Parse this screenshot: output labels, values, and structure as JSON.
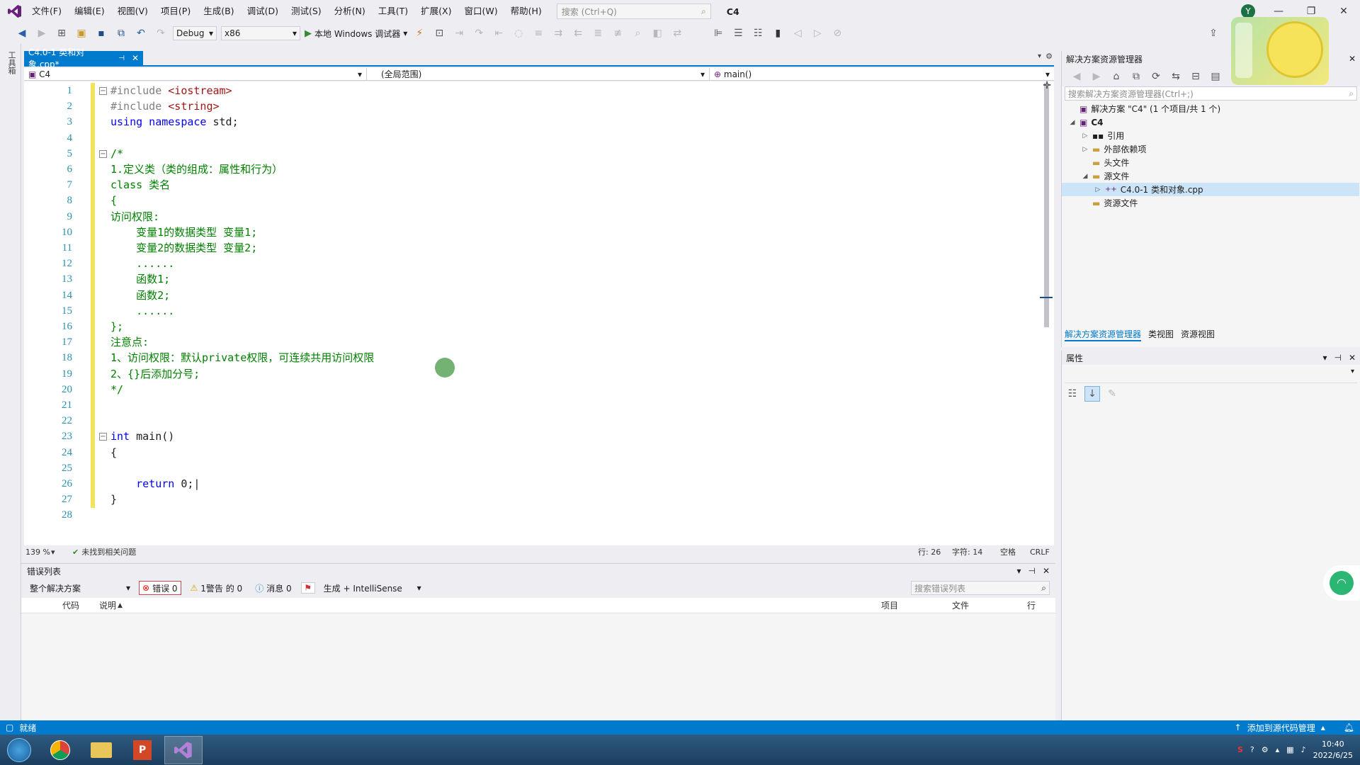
{
  "app": {
    "menu": [
      "文件(F)",
      "编辑(E)",
      "视图(V)",
      "项目(P)",
      "生成(B)",
      "调试(D)",
      "测试(S)",
      "分析(N)",
      "工具(T)",
      "扩展(X)",
      "窗口(W)",
      "帮助(H)"
    ],
    "search_placeholder": "搜索 (Ctrl+Q)",
    "solution_name": "C4",
    "account_initial": "Y"
  },
  "toolbar": {
    "config": "Debug",
    "platform": "x86",
    "run_label": "本地 Windows 调试器"
  },
  "left_rail_label": "工具箱",
  "editor": {
    "tab_title": "C4.0-1 类和对象.cpp*",
    "nav_project": "C4",
    "nav_scope": "(全局范围)",
    "nav_member": "main()",
    "lines": [
      {
        "n": "1",
        "fold": "−",
        "segs": [
          {
            "t": "#include ",
            "c": "pp"
          },
          {
            "t": "<iostream>",
            "c": "str"
          }
        ]
      },
      {
        "n": "2",
        "segs": [
          {
            "t": "#include ",
            "c": "pp"
          },
          {
            "t": "<string>",
            "c": "str"
          }
        ]
      },
      {
        "n": "3",
        "segs": [
          {
            "t": "using namespace ",
            "c": "kw"
          },
          {
            "t": "std;",
            "c": "plain"
          }
        ]
      },
      {
        "n": "4",
        "segs": []
      },
      {
        "n": "5",
        "fold": "−",
        "segs": [
          {
            "t": "/*",
            "c": "cm"
          }
        ]
      },
      {
        "n": "6",
        "segs": [
          {
            "t": "1.定义类（类的组成：属性和行为）",
            "c": "cm"
          }
        ]
      },
      {
        "n": "7",
        "segs": [
          {
            "t": "class 类名",
            "c": "cm"
          }
        ]
      },
      {
        "n": "8",
        "segs": [
          {
            "t": "{",
            "c": "cm"
          }
        ]
      },
      {
        "n": "9",
        "segs": [
          {
            "t": "访问权限:",
            "c": "cm"
          }
        ]
      },
      {
        "n": "10",
        "segs": [
          {
            "t": "    变量1的数据类型 变量1;",
            "c": "cm"
          }
        ]
      },
      {
        "n": "11",
        "segs": [
          {
            "t": "    变量2的数据类型 变量2;",
            "c": "cm"
          }
        ]
      },
      {
        "n": "12",
        "segs": [
          {
            "t": "    ......",
            "c": "cm"
          }
        ]
      },
      {
        "n": "13",
        "segs": [
          {
            "t": "    函数1;",
            "c": "cm"
          }
        ]
      },
      {
        "n": "14",
        "segs": [
          {
            "t": "    函数2;",
            "c": "cm"
          }
        ]
      },
      {
        "n": "15",
        "segs": [
          {
            "t": "    ......",
            "c": "cm"
          }
        ]
      },
      {
        "n": "16",
        "segs": [
          {
            "t": "};",
            "c": "cm"
          }
        ]
      },
      {
        "n": "17",
        "segs": [
          {
            "t": "注意点:",
            "c": "cm"
          }
        ]
      },
      {
        "n": "18",
        "segs": [
          {
            "t": "1、访问权限：默认private权限，可连续共用访问权限",
            "c": "cm"
          }
        ]
      },
      {
        "n": "19",
        "segs": [
          {
            "t": "2、{}后添加分号;",
            "c": "cm"
          }
        ]
      },
      {
        "n": "20",
        "segs": [
          {
            "t": "*/",
            "c": "cm"
          }
        ]
      },
      {
        "n": "21",
        "segs": []
      },
      {
        "n": "22",
        "segs": []
      },
      {
        "n": "23",
        "fold": "−",
        "segs": [
          {
            "t": "int ",
            "c": "kw"
          },
          {
            "t": "main()",
            "c": "plain"
          }
        ]
      },
      {
        "n": "24",
        "segs": [
          {
            "t": "{",
            "c": "plain"
          }
        ]
      },
      {
        "n": "25",
        "segs": []
      },
      {
        "n": "26",
        "segs": [
          {
            "t": "    return ",
            "c": "kw"
          },
          {
            "t": "0;|",
            "c": "plain"
          }
        ]
      },
      {
        "n": "27",
        "segs": [
          {
            "t": "}",
            "c": "plain"
          }
        ]
      },
      {
        "n": "28",
        "segs": []
      }
    ],
    "zoom": "139 %",
    "issues": "未找到相关问题",
    "line": "行: 26",
    "col": "字符: 14",
    "indent": "空格",
    "eol": "CRLF"
  },
  "error_list": {
    "title": "错误列表",
    "scope": "整个解决方案",
    "errors": "错误 0",
    "warnings": "1警告 的 0",
    "messages": "消息 0",
    "build_filter": "生成 + IntelliSense",
    "search_placeholder": "搜索错误列表",
    "columns": [
      "代码",
      "说明",
      "项目",
      "文件",
      "行"
    ]
  },
  "solution_explorer": {
    "title": "解决方案资源管理器",
    "search_placeholder": "搜索解决方案资源管理器(Ctrl+;)",
    "solution_root": "解决方案 \"C4\" (1 个项目/共 1 个)",
    "project": "C4",
    "nodes": [
      "引用",
      "外部依赖项",
      "头文件",
      "源文件",
      "C4.0-1 类和对象.cpp",
      "资源文件"
    ],
    "tabs": [
      "解决方案资源管理器",
      "类视图",
      "资源视图"
    ]
  },
  "properties": {
    "title": "属性"
  },
  "statusbar": {
    "left": "就绪",
    "right": "添加到源代码管理"
  },
  "clock": {
    "time": "10:40",
    "date": "2022/6/25"
  },
  "colors": {
    "accent": "#007acc",
    "comment": "#008000",
    "keyword": "#0000ff",
    "string": "#a31515"
  }
}
